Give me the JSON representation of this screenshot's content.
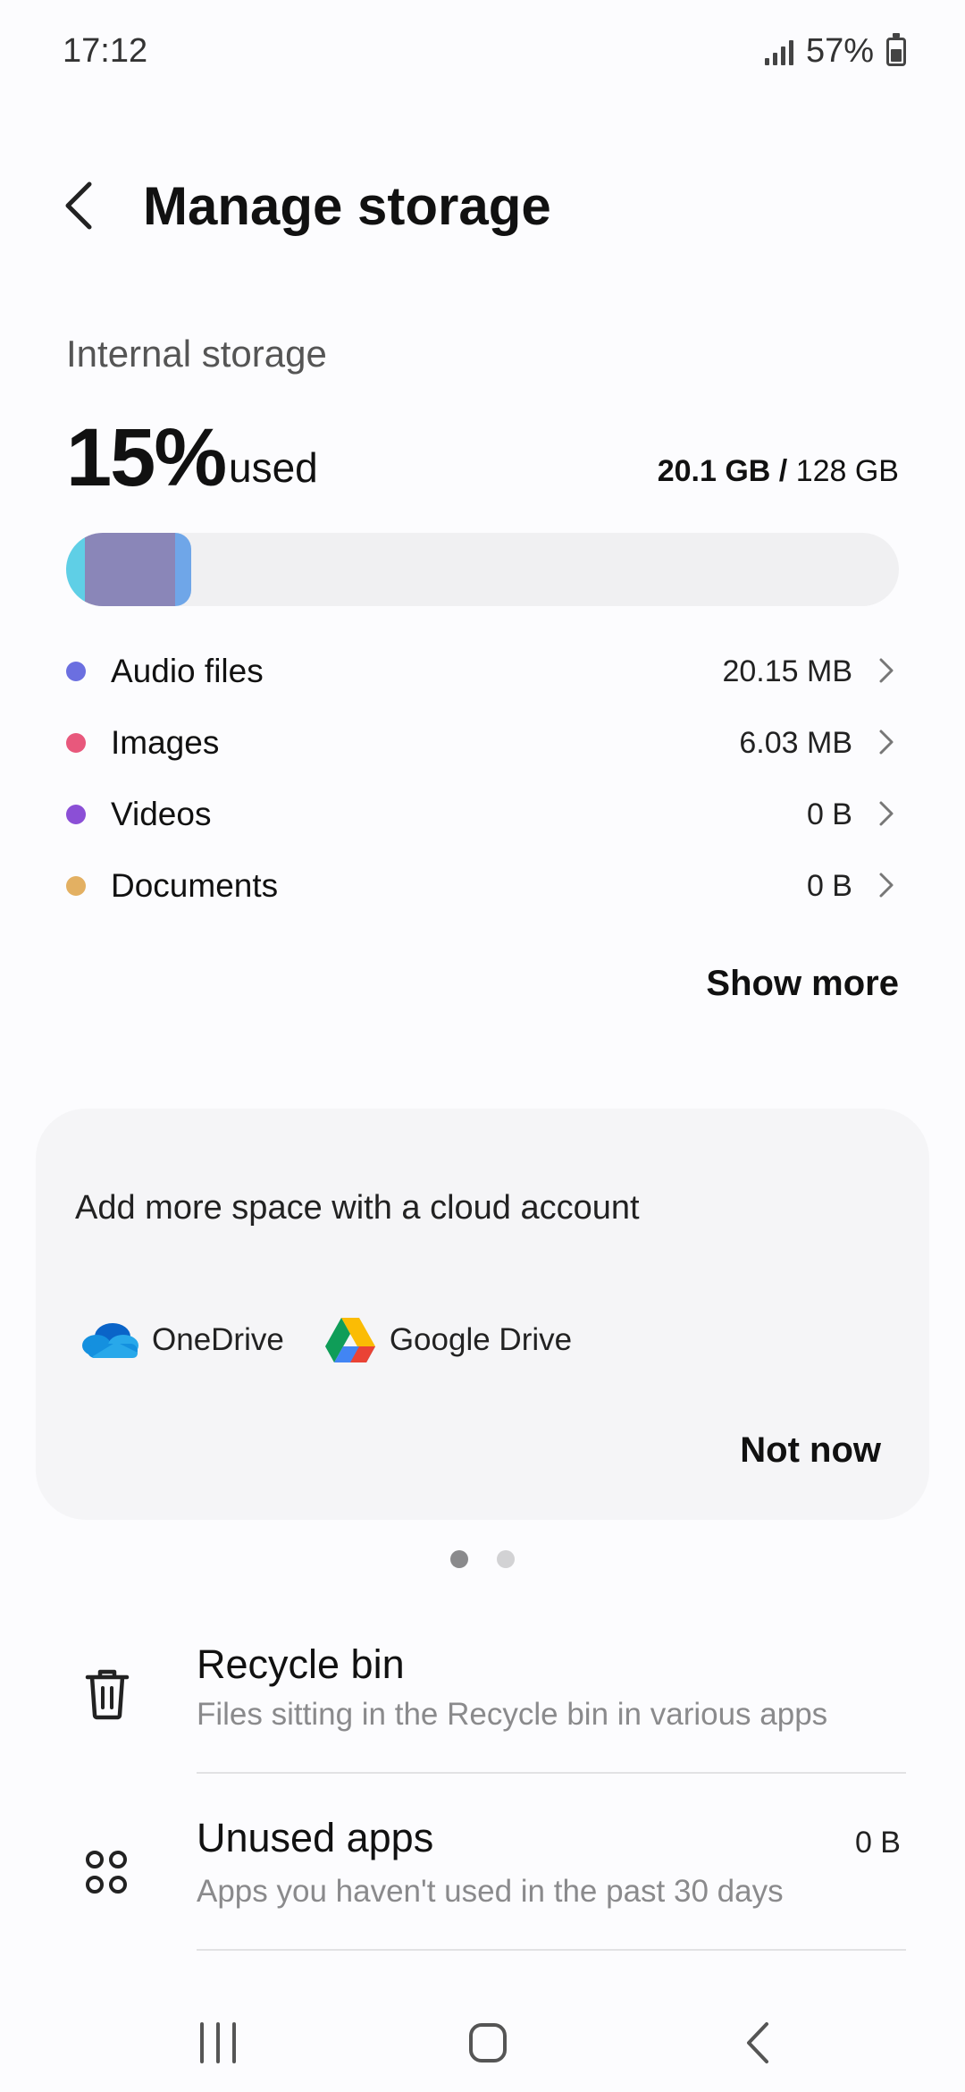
{
  "status": {
    "time": "17:12",
    "battery": "57%",
    "battery_level": 0.57
  },
  "header": {
    "title": "Manage storage"
  },
  "storage": {
    "section_label": "Internal storage",
    "percent": "15%",
    "used_word": "used",
    "used_amount": "20.1 GB /",
    "total_amount": "128 GB",
    "fraction_used": 0.15,
    "bar_segments": [
      {
        "name": "segment-cyan",
        "color": "#5fcfe6",
        "share": 0.15
      },
      {
        "name": "segment-purple",
        "color": "#8a86b8",
        "share": 0.72
      },
      {
        "name": "segment-blue",
        "color": "#6fa6e8",
        "share": 0.13
      }
    ]
  },
  "categories": [
    {
      "key": "audio",
      "label": "Audio files",
      "size": "20.15 MB",
      "color": "#6b6fe0"
    },
    {
      "key": "images",
      "label": "Images",
      "size": "6.03 MB",
      "color": "#e8587c"
    },
    {
      "key": "videos",
      "label": "Videos",
      "size": "0 B",
      "color": "#8b4fd6"
    },
    {
      "key": "documents",
      "label": "Documents",
      "size": "0 B",
      "color": "#e3b062"
    }
  ],
  "show_more": "Show more",
  "cloud": {
    "title": "Add more space with a cloud account",
    "options": [
      {
        "key": "onedrive",
        "label": "OneDrive",
        "icon": "onedrive-icon"
      },
      {
        "key": "googledrive",
        "label": "Google Drive",
        "icon": "google-drive-icon"
      }
    ],
    "dismiss": "Not now"
  },
  "pager": {
    "pages": 2,
    "active": 0
  },
  "tools": [
    {
      "key": "recycle-bin",
      "title": "Recycle bin",
      "subtitle": "Files sitting in the Recycle bin in various apps",
      "value": "",
      "icon": "trash-icon"
    },
    {
      "key": "unused-apps",
      "title": "Unused apps",
      "subtitle": "Apps you haven't used in the past 30 days",
      "value": "0 B",
      "icon": "apps-icon"
    }
  ],
  "nav": {
    "recents": "recents-icon",
    "home": "home-icon",
    "back": "back-icon"
  }
}
